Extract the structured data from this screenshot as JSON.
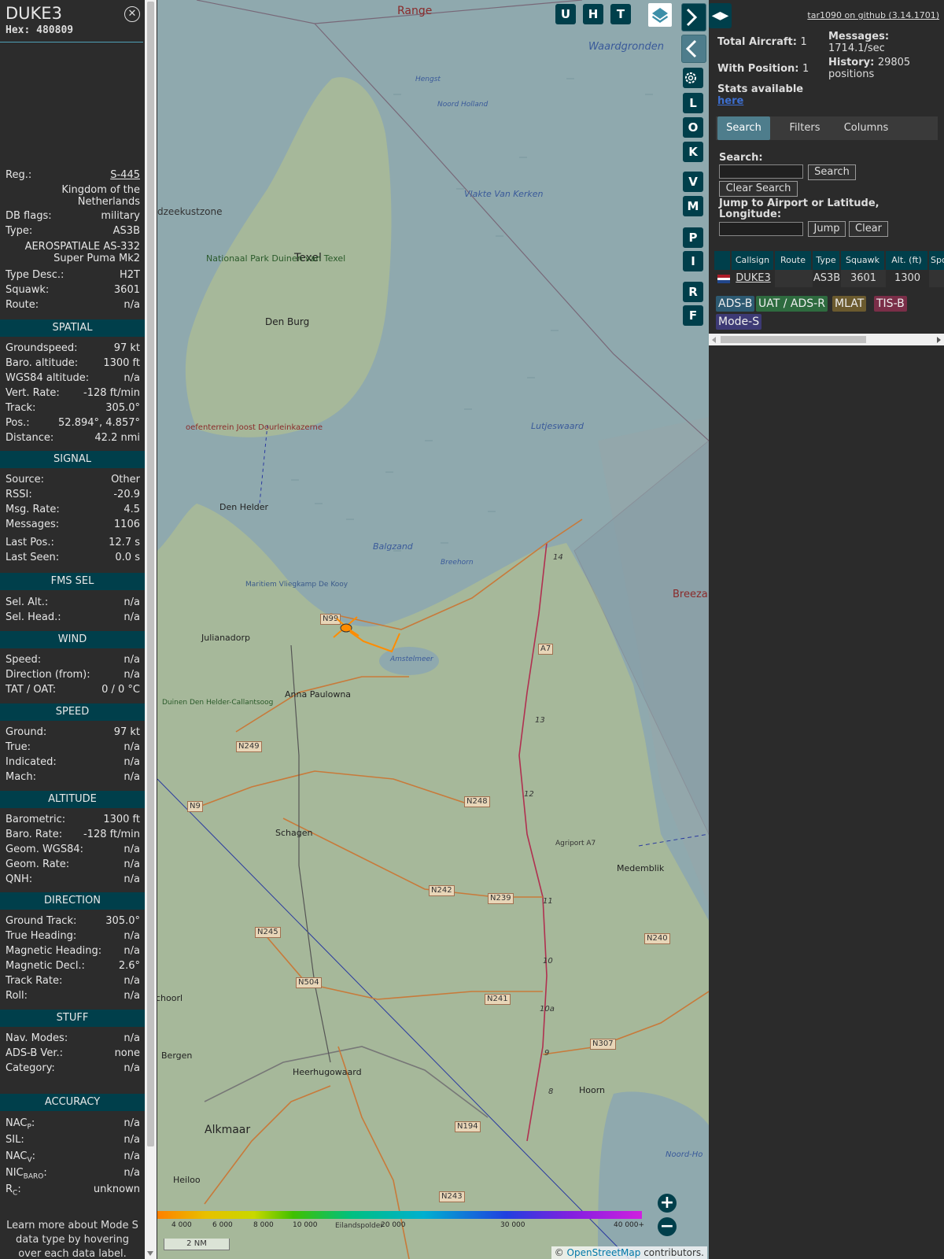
{
  "aircraft": {
    "callsign": "DUKE3",
    "hex_label": "Hex:",
    "hex": "480809",
    "close_icon": "close-icon"
  },
  "details": {
    "reg_label": "Reg.:",
    "reg": "S-445",
    "country": "Kingdom of the Netherlands",
    "country_line1": "Kingdom of the",
    "country_line2": "Netherlands",
    "dbflags_label": "DB flags:",
    "dbflags": "military",
    "type_label": "Type:",
    "type": "AS3B",
    "type_name_line1": "AEROSPATIALE AS-332",
    "type_name_line2": "Super Puma Mk2",
    "typedesc_label": "Type Desc.:",
    "typedesc": "H2T",
    "squawk_label": "Squawk:",
    "squawk": "3601",
    "route_label": "Route:",
    "route": "n/a"
  },
  "sections": {
    "spatial": "SPATIAL",
    "signal": "SIGNAL",
    "fms": "FMS SEL",
    "wind": "WIND",
    "speed": "SPEED",
    "altitude": "ALTITUDE",
    "direction": "DIRECTION",
    "stuff": "STUFF",
    "accuracy": "ACCURACY"
  },
  "spatial": [
    {
      "label": "Groundspeed:",
      "value": "97 kt"
    },
    {
      "label": "Baro. altitude:",
      "value": "1300 ft"
    },
    {
      "label": "WGS84 altitude:",
      "value": "n/a"
    },
    {
      "label": "Vert. Rate:",
      "value": "-128 ft/min"
    },
    {
      "label": "Track:",
      "value": "305.0°"
    },
    {
      "label": "Pos.:",
      "value": "52.894°, 4.857°"
    },
    {
      "label": "Distance:",
      "value": "42.2 nmi"
    }
  ],
  "signal": [
    {
      "label": "Source:",
      "value": "Other"
    },
    {
      "label": "RSSI:",
      "value": "-20.9"
    },
    {
      "label": "Msg. Rate:",
      "value": "4.5"
    },
    {
      "label": "Messages:",
      "value": "1106"
    },
    {
      "label": "Last Pos.:",
      "value": "12.7 s"
    },
    {
      "label": "Last Seen:",
      "value": "0.0 s"
    }
  ],
  "fms": [
    {
      "label": "Sel. Alt.:",
      "value": "n/a"
    },
    {
      "label": "Sel. Head.:",
      "value": "n/a"
    }
  ],
  "wind": [
    {
      "label": "Speed:",
      "value": "n/a"
    },
    {
      "label": "Direction (from):",
      "value": "n/a"
    },
    {
      "label": "TAT / OAT:",
      "value": "0 / 0 °C"
    }
  ],
  "speed": [
    {
      "label": "Ground:",
      "value": "97 kt"
    },
    {
      "label": "True:",
      "value": "n/a"
    },
    {
      "label": "Indicated:",
      "value": "n/a"
    },
    {
      "label": "Mach:",
      "value": "n/a"
    }
  ],
  "altitude": [
    {
      "label": "Barometric:",
      "value": "1300 ft"
    },
    {
      "label": "Baro. Rate:",
      "value": "-128 ft/min"
    },
    {
      "label": "Geom. WGS84:",
      "value": "n/a"
    },
    {
      "label": "Geom. Rate:",
      "value": "n/a"
    },
    {
      "label": "QNH:",
      "value": "n/a"
    }
  ],
  "direction": [
    {
      "label": "Ground Track:",
      "value": "305.0°"
    },
    {
      "label": "True Heading:",
      "value": "n/a"
    },
    {
      "label": "Magnetic Heading:",
      "value": "n/a"
    },
    {
      "label": "Magnetic Decl.:",
      "value": "2.6°"
    },
    {
      "label": "Track Rate:",
      "value": "n/a"
    },
    {
      "label": "Roll:",
      "value": "n/a"
    }
  ],
  "stuff": [
    {
      "label": "Nav. Modes:",
      "value": "n/a"
    },
    {
      "label": "ADS-B Ver.:",
      "value": "none"
    },
    {
      "label": "Category:",
      "value": "n/a"
    }
  ],
  "accuracy": [
    {
      "label": "NACP:",
      "value": "n/a"
    },
    {
      "label": "SIL:",
      "value": "n/a"
    },
    {
      "label": "NACV:",
      "value": "n/a"
    },
    {
      "label": "NICBARO:",
      "value": "n/a"
    },
    {
      "label": "RC:",
      "value": "unknown"
    }
  ],
  "footer_note": "Learn more about Mode S data type by hovering over each data label.",
  "map": {
    "buttons_top": [
      "U",
      "H",
      "T"
    ],
    "layers_icon": "layers-icon",
    "side_buttons": [
      "L",
      "O",
      "K",
      "V",
      "M",
      "P",
      "I",
      "R",
      "F"
    ],
    "settings_icon": "gear-icon",
    "next_icon": "chevron-right-icon",
    "prev_icon": "chevron-left-icon",
    "zoom_in": "+",
    "zoom_out": "−",
    "scale": "2 NM",
    "attribution_prefix": "© ",
    "attribution_link": "OpenStreetMap",
    "attribution_suffix": " contributors.",
    "altitude_scale": [
      "4 000",
      "6 000",
      "8 000",
      "10 000",
      "20 000",
      "30 000",
      "40 000+"
    ],
    "places": [
      {
        "name": "Range",
        "kind": "area"
      },
      {
        "name": "Waardgronden",
        "kind": "water"
      },
      {
        "name": "Hengst",
        "kind": "water"
      },
      {
        "name": "Noord Holland",
        "kind": "water"
      },
      {
        "name": "Vlakte Van Kerken",
        "kind": "water"
      },
      {
        "name": "dzeekustzone",
        "kind": "area"
      },
      {
        "name": "Texel",
        "kind": "island"
      },
      {
        "name": "Nationaal Park Duinen van Texel",
        "kind": "park"
      },
      {
        "name": "Den Burg",
        "kind": "town"
      },
      {
        "name": "Lutjeswaard",
        "kind": "water"
      },
      {
        "name": "oefenterrein Joost Dourleinkazerne",
        "kind": "area"
      },
      {
        "name": "Den Helder",
        "kind": "town"
      },
      {
        "name": "Balgzand",
        "kind": "water"
      },
      {
        "name": "Breehorn",
        "kind": "water"
      },
      {
        "name": "Breeza",
        "kind": "area"
      },
      {
        "name": "Maritiem Vliegkamp De Kooy",
        "kind": "area"
      },
      {
        "name": "Julianadorp",
        "kind": "town"
      },
      {
        "name": "Amstelmeer",
        "kind": "water"
      },
      {
        "name": "Anna Paulowna",
        "kind": "town"
      },
      {
        "name": "Duinen Den Helder-Callantsoog",
        "kind": "park"
      },
      {
        "name": "Schagen",
        "kind": "town"
      },
      {
        "name": "Agriport A7",
        "kind": "area"
      },
      {
        "name": "Medemblik",
        "kind": "town"
      },
      {
        "name": "choorl",
        "kind": "town"
      },
      {
        "name": "Bergen",
        "kind": "town"
      },
      {
        "name": "Heerhugowaard",
        "kind": "town"
      },
      {
        "name": "Hoorn",
        "kind": "town"
      },
      {
        "name": "Alkmaar",
        "kind": "city"
      },
      {
        "name": "Heiloo",
        "kind": "town"
      },
      {
        "name": "Eilandspolder",
        "kind": "area"
      },
      {
        "name": "Noord-Ho",
        "kind": "water"
      }
    ],
    "road_labels": [
      "N99",
      "A7",
      "N249",
      "N9",
      "N248",
      "N242",
      "N239",
      "N245",
      "N504",
      "N241",
      "N240",
      "N307",
      "N194",
      "N243",
      "14",
      "13",
      "12",
      "11",
      "10",
      "10a",
      "9",
      "8"
    ]
  },
  "right": {
    "toggle_icon": "expand-collapse-icon",
    "github_link": "tar1090 on github (3.14.1701)",
    "total_label": "Total Aircraft:",
    "total": "1",
    "withpos_label": "With Position:",
    "withpos": "1",
    "messages_label": "Messages:",
    "messages": "1714.1/sec",
    "history_label": "History:",
    "history": "29805",
    "history_unit": "positions",
    "stats_text": "Stats available",
    "stats_link": "here",
    "tabs": [
      "Search",
      "Filters",
      "Columns"
    ],
    "search_label": "Search:",
    "search_button": "Search",
    "clear_search_button": "Clear Search",
    "jump_label_line1": "Jump to Airport or Latitude,",
    "jump_label_line2": "Longitude:",
    "jump_button": "Jump",
    "clear_button": "Clear",
    "columns": [
      "Callsign",
      "Route",
      "Type",
      "Squawk",
      "Alt. (ft)",
      "Spd."
    ],
    "rows": [
      {
        "callsign": "DUKE3",
        "route": "",
        "type": "AS3B",
        "squawk": "3601",
        "alt": "1300",
        "spd": ""
      }
    ],
    "sources": [
      {
        "label": "ADS-B",
        "color": "#2d5a72"
      },
      {
        "label": "UAT / ADS-R",
        "color": "#2e6b3f"
      },
      {
        "label": "MLAT",
        "color": "#6b5a2e"
      },
      {
        "label": "TIS-B",
        "color": "#7a2e48"
      },
      {
        "label": "Mode-S",
        "color": "#3d3a75"
      }
    ]
  }
}
